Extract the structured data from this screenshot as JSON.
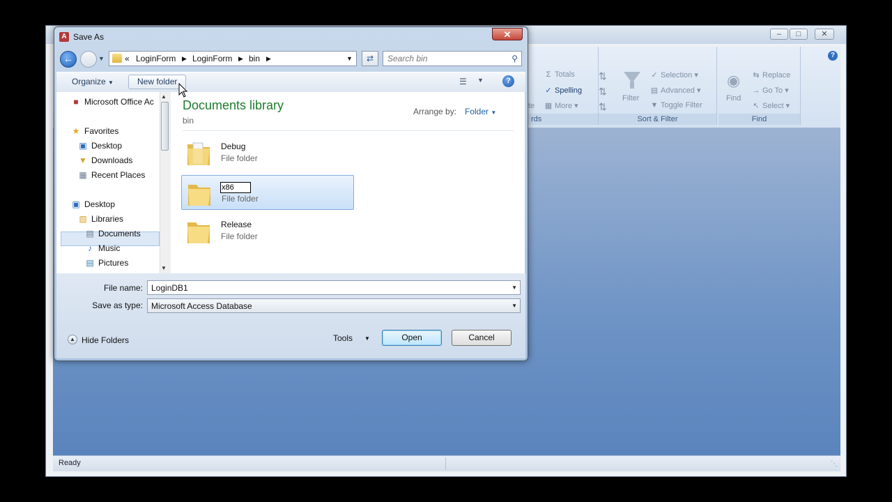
{
  "app": {
    "ribbon": {
      "records_group_partial": "rds",
      "records_partial_item": "te",
      "sort_filter": {
        "totals": "Totals",
        "spelling": "Spelling",
        "more": "More",
        "selection": "Selection",
        "advanced": "Advanced",
        "toggle_filter": "Toggle Filter",
        "filter": "Filter",
        "label": "Sort & Filter"
      },
      "find": {
        "find": "Find",
        "replace": "Replace",
        "goto": "Go To",
        "select": "Select",
        "label": "Find"
      }
    },
    "status": "Ready"
  },
  "dialog": {
    "title": "Save As",
    "breadcrumb": {
      "overflow": "«",
      "items": [
        "LoginForm",
        "LoginForm",
        "bin"
      ]
    },
    "search_placeholder": "Search bin",
    "toolbar": {
      "organize": "Organize",
      "new_folder": "New folder"
    },
    "nav": {
      "items": [
        {
          "label": "Microsoft Office Ac"
        },
        {
          "label": "Favorites"
        },
        {
          "label": "Desktop"
        },
        {
          "label": "Downloads"
        },
        {
          "label": "Recent Places"
        },
        {
          "label": "Desktop"
        },
        {
          "label": "Libraries"
        },
        {
          "label": "Documents"
        },
        {
          "label": "Music"
        },
        {
          "label": "Pictures"
        }
      ]
    },
    "content": {
      "library_title": "Documents library",
      "library_subtitle": "bin",
      "arrange_label": "Arrange by:",
      "arrange_value": "Folder",
      "folders": [
        {
          "name": "Debug",
          "type": "File folder"
        },
        {
          "name": "x86",
          "type": "File folder"
        },
        {
          "name": "Release",
          "type": "File folder"
        }
      ]
    },
    "bottom": {
      "file_name_label": "File name:",
      "file_name_value": "LoginDB1",
      "save_type_label": "Save as type:",
      "save_type_value": "Microsoft Access Database",
      "hide_folders": "Hide Folders",
      "tools": "Tools",
      "open": "Open",
      "cancel": "Cancel"
    }
  },
  "colors": {
    "library_title": "#1e7b2d",
    "selection_fill": "#c9e0f8",
    "workspace": "#7095c6",
    "close_button": "#c3483a"
  }
}
